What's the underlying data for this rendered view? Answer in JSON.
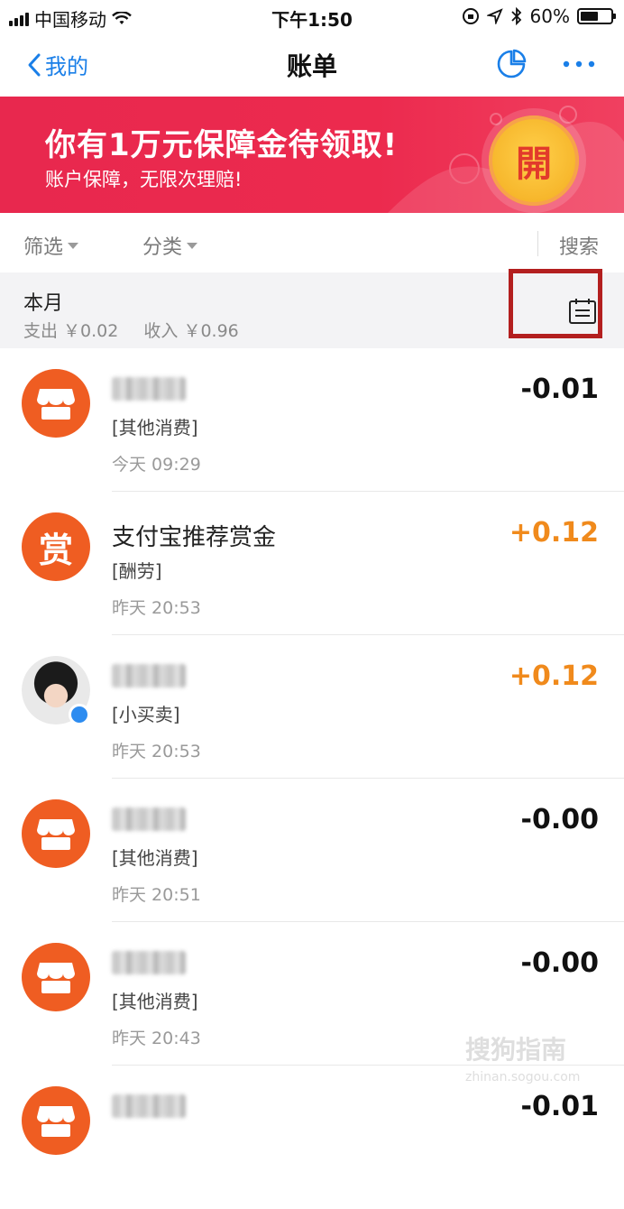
{
  "status_bar": {
    "carrier": "中国移动",
    "time": "下午1:50",
    "battery": "60%",
    "battery_level": 0.6
  },
  "nav": {
    "back_label": "我的",
    "title": "账单"
  },
  "banner": {
    "title": "你有1万元保障金待领取!",
    "subtitle": "账户保障，无限次理赔!",
    "button_label": "開"
  },
  "filters": {
    "filter_label": "筛选",
    "category_label": "分类",
    "search_label": "搜索"
  },
  "month": {
    "title": "本月",
    "expense": "支出 ￥0.02",
    "income": "收入 ￥0.96"
  },
  "transactions": [
    {
      "name": "",
      "category": "[其他消费]",
      "time": "今天  09:29",
      "amount": "-0.01"
    },
    {
      "name": "支付宝推荐赏金",
      "avatar_text": "赏",
      "category": "[酬劳]",
      "time": "昨天  20:53",
      "amount": "+0.12"
    },
    {
      "name": "",
      "category": "[小买卖]",
      "time": "昨天  20:53",
      "amount": "+0.12"
    },
    {
      "name": "",
      "category": "[其他消费]",
      "time": "昨天  20:51",
      "amount": "-0.00"
    },
    {
      "name": "",
      "category": "[其他消费]",
      "time": "昨天  20:43",
      "amount": "-0.00"
    },
    {
      "name": "",
      "category": "",
      "time": "",
      "amount": "-0.01"
    }
  ],
  "watermark": {
    "main": "搜狗指南",
    "sub": "zhinan.sogou.com"
  },
  "colors": {
    "accent_blue": "#1a7fe8",
    "banner_red": "#e8284e",
    "income_orange": "#f08a1c",
    "shop_orange": "#ef5d22",
    "highlight_red": "#b31f1f"
  }
}
